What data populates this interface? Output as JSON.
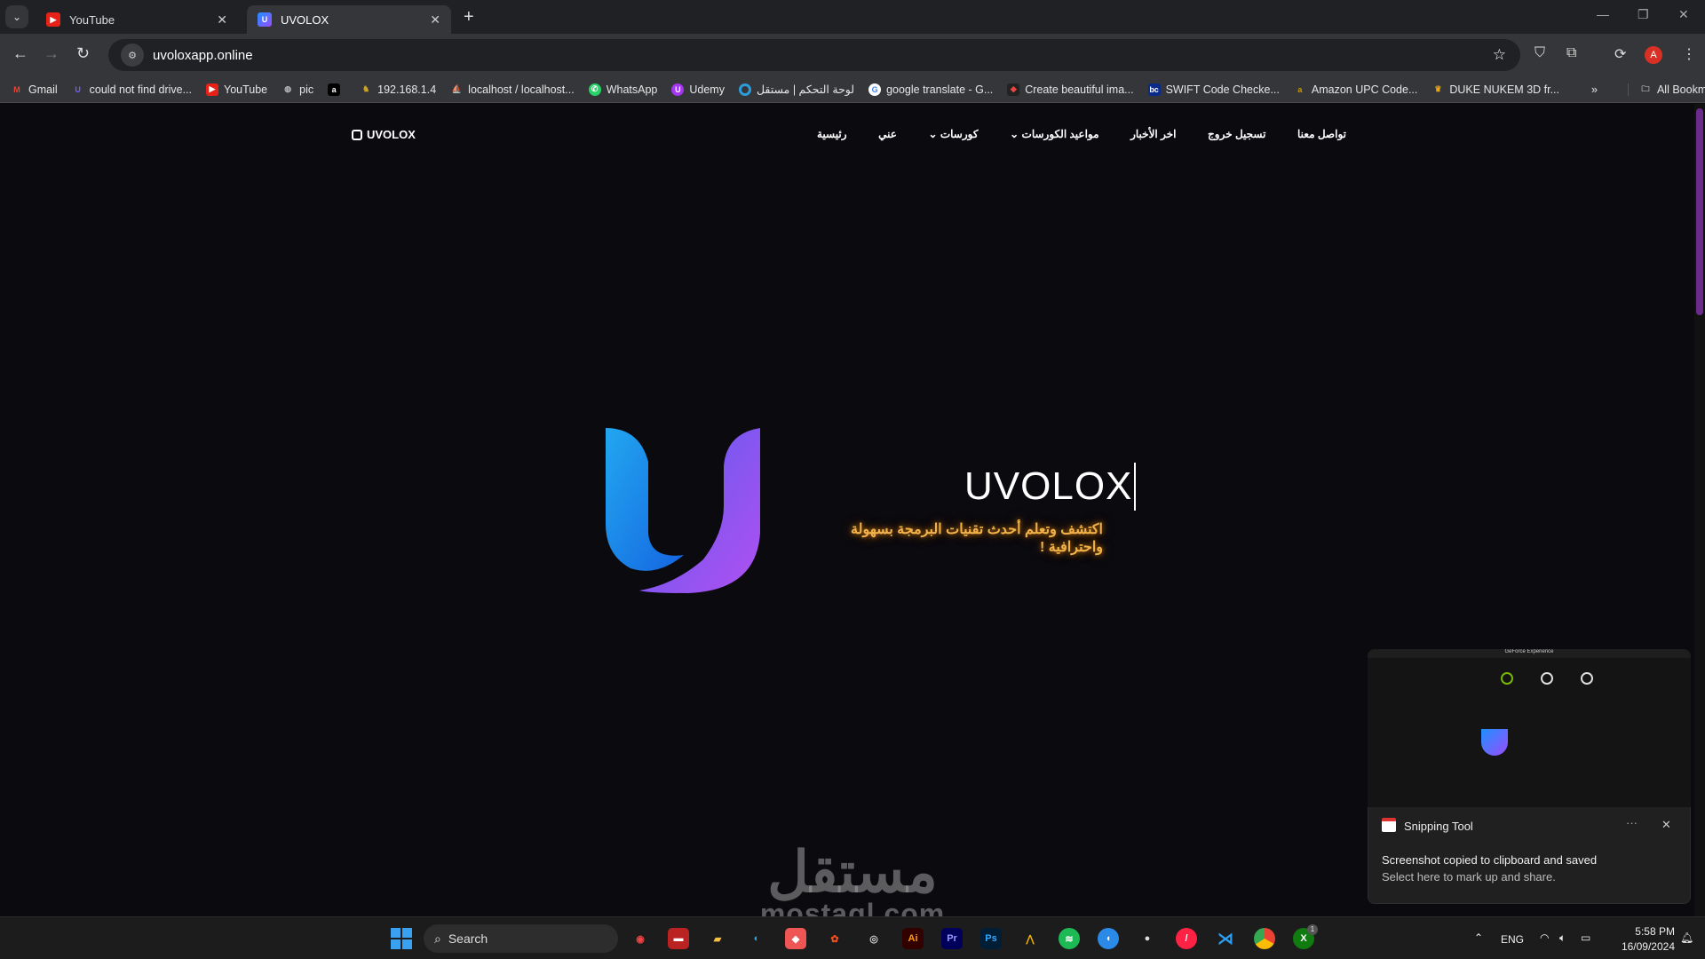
{
  "browser": {
    "tabs": [
      {
        "title": "YouTube",
        "active": false
      },
      {
        "title": "UVOLOX",
        "active": true
      }
    ],
    "url": "uvoloxapp.online",
    "bookmarks": [
      "Gmail",
      "could not find drive...",
      "YouTube",
      "pic",
      "",
      "192.168.1.4",
      "localhost / localhost...",
      "WhatsApp",
      "Udemy",
      "لوحة التحكم | مستقل",
      "google translate - G...",
      "Create beautiful ima...",
      "SWIFT Code Checke...",
      "Amazon UPC Code...",
      "DUKE NUKEM 3D fr..."
    ],
    "all_bookmarks": "All Bookmarks",
    "profile_initial": "A"
  },
  "site": {
    "logo": "UVOLOX",
    "nav": [
      "تواصل معنا",
      "تسجيل خروج",
      "اخر الأخبار",
      "مواعيد الكورسات",
      "كورسات",
      "عني",
      "رئيسية"
    ],
    "hero_title": "UVOLOX",
    "tagline": "اكتشف وتعلم أحدث تقنيات البرمجة بسهولة واحترافية !",
    "accent": "#f1b24a"
  },
  "watermark": {
    "arabic": "مستقل",
    "latin": "mostaql.com"
  },
  "notification": {
    "app": "Snipping Tool",
    "title": "Screenshot copied to clipboard and saved",
    "body": "Select here to mark up and share.",
    "preview_title": "GeForce Experience"
  },
  "taskbar": {
    "search": "Search",
    "language": "ENG",
    "time": "5:58 PM",
    "date": "16/09/2024",
    "xbox_badge": "1"
  }
}
